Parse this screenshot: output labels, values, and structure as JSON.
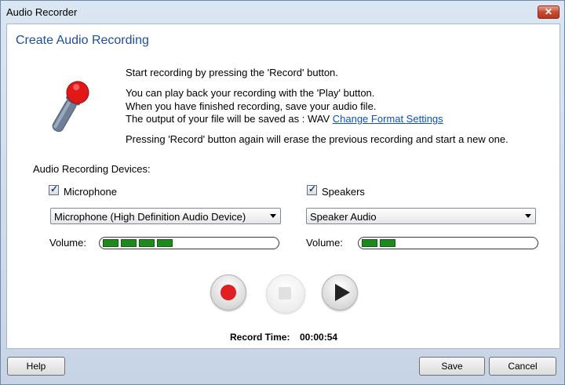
{
  "window": {
    "title": "Audio Recorder",
    "close_label": "✕"
  },
  "heading": "Create Audio Recording",
  "intro": {
    "line1": "Start recording by pressing the 'Record' button.",
    "line2": "You can play back your recording with the 'Play' button.",
    "line3": "When you have finished recording, save your audio file.",
    "line4_prefix": "The output of your file will be saved as : WAV",
    "line4_link": "Change Format Settings",
    "line5": "Pressing 'Record' button again will erase the previous recording and start a new one."
  },
  "devices": {
    "label": "Audio Recording Devices:",
    "microphone": {
      "label": "Microphone",
      "checked": true,
      "selected": "Microphone (High Definition Audio Device)",
      "volume_label": "Volume:",
      "level_segments": 4
    },
    "speakers": {
      "label": "Speakers",
      "checked": true,
      "selected": "Speaker Audio",
      "volume_label": "Volume:",
      "level_segments": 2
    }
  },
  "controls": {
    "record_icon": "record-icon",
    "stop_icon": "stop-icon",
    "play_icon": "play-icon"
  },
  "record_time": {
    "label": "Record Time:",
    "value": "00:00:54"
  },
  "footer": {
    "help": "Help",
    "save": "Save",
    "cancel": "Cancel"
  },
  "colors": {
    "heading": "#1e4e9c",
    "link": "#0d4fc2",
    "record": "#e02020",
    "meter": "#1e8a1e"
  }
}
